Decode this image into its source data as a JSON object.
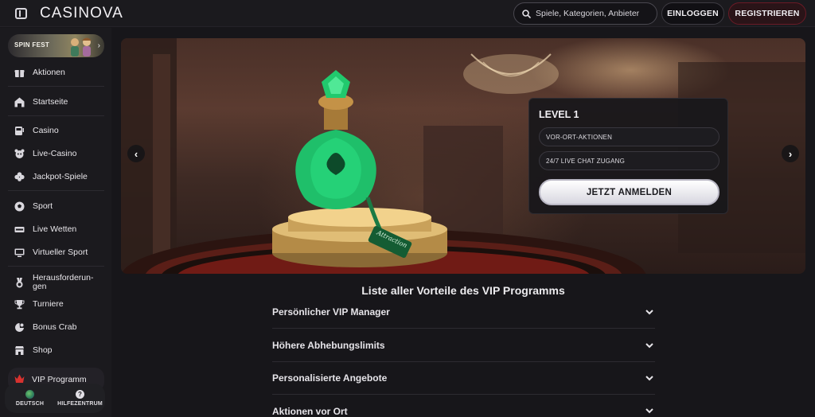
{
  "header": {
    "logo": "CASINOVA",
    "search_placeholder": "Spiele, Kategorien, Anbieter",
    "login_label": "EINLOGGEN",
    "register_label": "REGISTRIEREN"
  },
  "sidebar": {
    "promo_label": "SPIN FEST",
    "items": [
      {
        "label": "Aktionen",
        "icon": "gift-icon"
      },
      {
        "label": "Startseite",
        "icon": "home-icon"
      },
      {
        "label": "Casino",
        "icon": "slot-machine-icon"
      },
      {
        "label": "Live-Casino",
        "icon": "live-casino-icon"
      },
      {
        "label": "Jackpot-Spiele",
        "icon": "clover-icon"
      },
      {
        "label": "Sport",
        "icon": "soccer-ball-icon"
      },
      {
        "label": "Live Wetten",
        "icon": "live-badge-icon"
      },
      {
        "label": "Virtueller Sport",
        "icon": "screen-icon"
      },
      {
        "label": "Herausforderun-gen",
        "icon": "medal-icon"
      },
      {
        "label": "Turniere",
        "icon": "trophy-icon"
      },
      {
        "label": "Bonus Crab",
        "icon": "crab-claw-icon"
      },
      {
        "label": "Shop",
        "icon": "shop-icon"
      }
    ],
    "vip_label": "VIP Programm",
    "language_label": "DEUTSCH",
    "help_label": "HILFEZENTRUM"
  },
  "hero": {
    "level_title": "LEVEL 1",
    "perks": [
      "VOR-ORT-AKTIONEN",
      "24/7 LIVE CHAT ZUGANG"
    ],
    "cta_label": "JETZT ANMELDEN",
    "bottle_tag": "Attraction"
  },
  "benefits": {
    "title": "Liste aller Vorteile des VIP Programms",
    "items": [
      "Persönlicher VIP Manager",
      "Höhere Abhebungslimits",
      "Personalisierte Angebote",
      "Aktionen vor Ort"
    ]
  },
  "colors": {
    "background": "#17161a",
    "panel": "#1b1a1e",
    "register_accent": "#6b1a26",
    "emerald": "#1fbf6a",
    "gold": "#c9a15a"
  }
}
